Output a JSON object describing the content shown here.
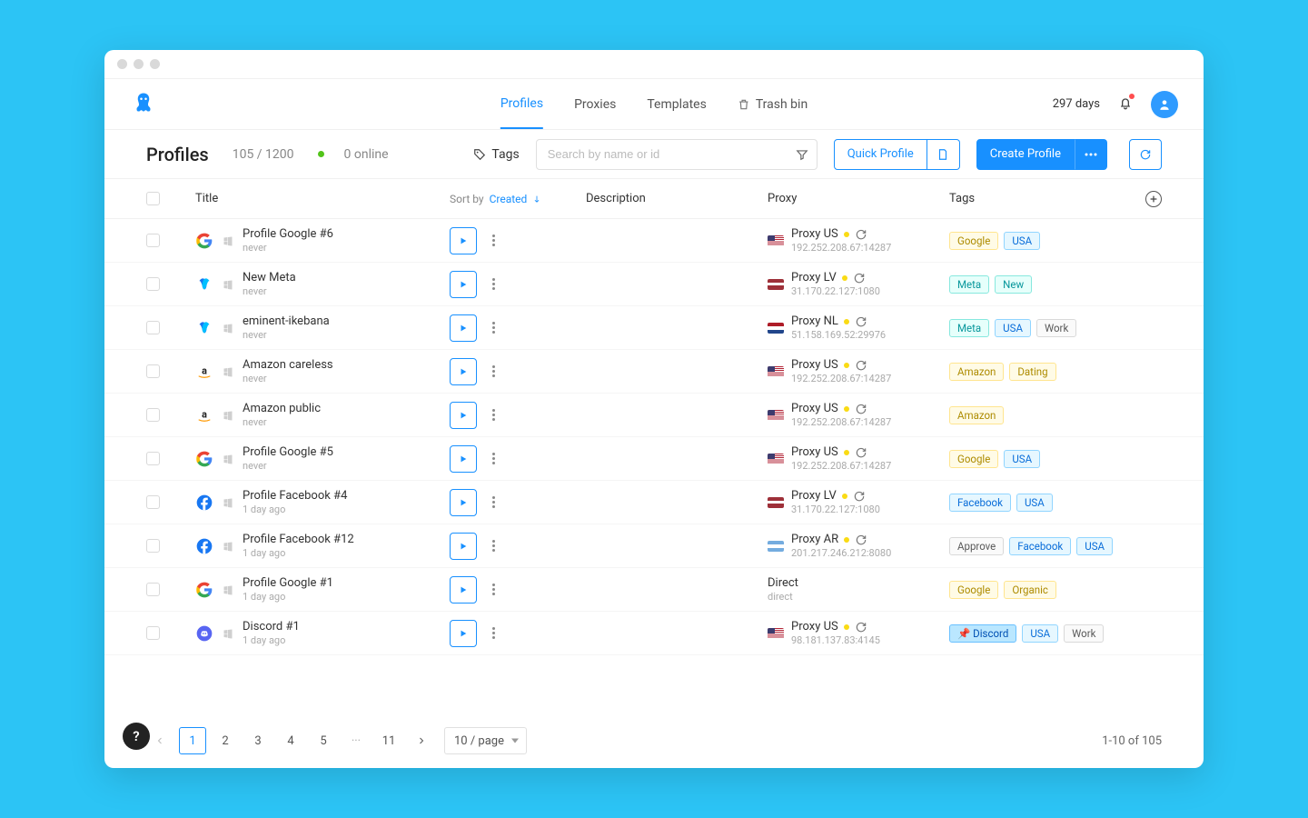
{
  "nav": {
    "tabs": [
      "Profiles",
      "Proxies",
      "Templates",
      "Trash bin"
    ],
    "active_index": 0,
    "days_label": "297 days"
  },
  "header": {
    "title": "Profiles",
    "count": "105 / 1200",
    "online": "0 online",
    "tags_label": "Tags",
    "search_placeholder": "Search by name or id",
    "quick_profile": "Quick Profile",
    "create_profile": "Create Profile"
  },
  "columns": {
    "title": "Title",
    "sort_prefix": "Sort by",
    "sort_value": "Created",
    "description": "Description",
    "proxy": "Proxy",
    "tags": "Tags"
  },
  "rows": [
    {
      "icon": "google",
      "os": "win",
      "title": "Profile Google #6",
      "sub": "never",
      "proxy": {
        "flag": "us",
        "name": "Proxy US",
        "addr": "192.252.208.67:14287"
      },
      "tags": [
        {
          "t": "Google",
          "c": "yellow"
        },
        {
          "t": "USA",
          "c": "blue"
        }
      ]
    },
    {
      "icon": "meta",
      "os": "win",
      "title": "New Meta",
      "sub": "never",
      "proxy": {
        "flag": "lv",
        "name": "Proxy LV",
        "addr": "31.170.22.127:1080"
      },
      "tags": [
        {
          "t": "Meta",
          "c": "teal"
        },
        {
          "t": "New",
          "c": "teal"
        }
      ]
    },
    {
      "icon": "meta",
      "os": "win",
      "title": "eminent-ikebana",
      "sub": "never",
      "proxy": {
        "flag": "nl",
        "name": "Proxy NL",
        "addr": "51.158.169.52:29976"
      },
      "tags": [
        {
          "t": "Meta",
          "c": "teal"
        },
        {
          "t": "USA",
          "c": "blue"
        },
        {
          "t": "Work",
          "c": "gray"
        }
      ]
    },
    {
      "icon": "amazon",
      "os": "win",
      "title": "Amazon careless",
      "sub": "never",
      "proxy": {
        "flag": "us",
        "name": "Proxy US",
        "addr": "192.252.208.67:14287"
      },
      "tags": [
        {
          "t": "Amazon",
          "c": "yellow"
        },
        {
          "t": "Dating",
          "c": "yellow"
        }
      ]
    },
    {
      "icon": "amazon",
      "os": "win",
      "title": "Amazon public",
      "sub": "never",
      "proxy": {
        "flag": "us",
        "name": "Proxy US",
        "addr": "192.252.208.67:14287"
      },
      "tags": [
        {
          "t": "Amazon",
          "c": "yellow"
        }
      ]
    },
    {
      "icon": "google",
      "os": "win",
      "title": "Profile Google #5",
      "sub": "never",
      "proxy": {
        "flag": "us",
        "name": "Proxy US",
        "addr": "192.252.208.67:14287"
      },
      "tags": [
        {
          "t": "Google",
          "c": "yellow"
        },
        {
          "t": "USA",
          "c": "blue"
        }
      ]
    },
    {
      "icon": "facebook",
      "os": "win",
      "title": "Profile Facebook #4",
      "sub": "1 day ago",
      "proxy": {
        "flag": "lv",
        "name": "Proxy LV",
        "addr": "31.170.22.127:1080"
      },
      "tags": [
        {
          "t": "Facebook",
          "c": "blue"
        },
        {
          "t": "USA",
          "c": "blue"
        }
      ]
    },
    {
      "icon": "facebook",
      "os": "win",
      "title": "Profile Facebook #12",
      "sub": "1 day ago",
      "proxy": {
        "flag": "ar",
        "name": "Proxy AR",
        "addr": "201.217.246.212:8080"
      },
      "tags": [
        {
          "t": "Approve",
          "c": "gray"
        },
        {
          "t": "Facebook",
          "c": "blue"
        },
        {
          "t": "USA",
          "c": "blue"
        }
      ]
    },
    {
      "icon": "google",
      "os": "win",
      "title": "Profile Google #1",
      "sub": "1 day ago",
      "proxy": {
        "direct": true,
        "name": "Direct",
        "addr": "direct"
      },
      "tags": [
        {
          "t": "Google",
          "c": "yellow"
        },
        {
          "t": "Organic",
          "c": "yellow"
        }
      ]
    },
    {
      "icon": "discord",
      "os": "win",
      "title": "Discord #1",
      "sub": "1 day ago",
      "proxy": {
        "flag": "us",
        "name": "Proxy US",
        "addr": "98.181.137.83:4145"
      },
      "tags": [
        {
          "t": "Discord",
          "c": "bluefill",
          "pin": true
        },
        {
          "t": "USA",
          "c": "blue"
        },
        {
          "t": "Work",
          "c": "gray"
        }
      ]
    }
  ],
  "footer": {
    "pages": [
      "1",
      "2",
      "3",
      "4",
      "5"
    ],
    "dots": "···",
    "last": "11",
    "active": 0,
    "per_page": "10 / page",
    "range": "1-10 of 105"
  }
}
